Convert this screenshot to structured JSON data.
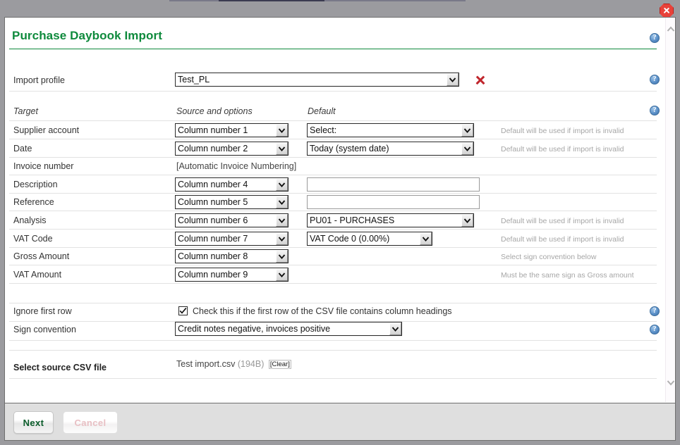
{
  "window": {
    "close_icon": "close-icon"
  },
  "page": {
    "title": "Purchase Daybook Import"
  },
  "profile": {
    "label": "Import profile",
    "value": "Test_PL",
    "delete_icon": "delete-icon",
    "help_icon": "help-icon"
  },
  "columns": {
    "target": "Target",
    "source": "Source and options",
    "default": "Default"
  },
  "rows": [
    {
      "target": "Supplier account",
      "source": "Column number 1",
      "source_type": "select",
      "default": "Select:",
      "default_type": "select",
      "default_width": 237,
      "hint": "Default will be used if import is invalid"
    },
    {
      "target": "Date",
      "source": "Column number 2",
      "source_type": "select",
      "default": "Today (system date)",
      "default_type": "select",
      "default_width": 237,
      "hint": "Default will be used if import is invalid"
    },
    {
      "target": "Invoice number",
      "source": "[Automatic Invoice Numbering]",
      "source_type": "text-static",
      "default": "",
      "default_type": "none",
      "hint": ""
    },
    {
      "target": "Description",
      "source": "Column number 4",
      "source_type": "select",
      "default": "",
      "default_type": "input",
      "default_width": 245,
      "hint": ""
    },
    {
      "target": "Reference",
      "source": "Column number 5",
      "source_type": "select",
      "default": "",
      "default_type": "input",
      "default_width": 245,
      "hint": ""
    },
    {
      "target": "Analysis",
      "source": "Column number 6",
      "source_type": "select",
      "default": "PU01 - PURCHASES",
      "default_type": "select",
      "default_width": 237,
      "hint": "Default will be used if import is invalid"
    },
    {
      "target": "VAT Code",
      "source": "Column number 7",
      "source_type": "select",
      "default": "VAT Code 0 (0.00%)",
      "default_type": "select",
      "default_width": 178,
      "hint": "Default will be used if import is invalid"
    },
    {
      "target": "Gross Amount",
      "source": "Column number 8",
      "source_type": "select",
      "default": "",
      "default_type": "none",
      "hint": "Select sign convention below"
    },
    {
      "target": "VAT Amount",
      "source": "Column number 9",
      "source_type": "select",
      "default": "",
      "default_type": "none",
      "hint": "Must be the same sign as Gross amount"
    }
  ],
  "ignore_first_row": {
    "label": "Ignore first row",
    "checked": true,
    "description": "Check this if the first row of the CSV file contains column headings"
  },
  "sign_convention": {
    "label": "Sign convention",
    "value": "Credit notes negative, invoices positive"
  },
  "csv_file": {
    "label": "Select source CSV file",
    "name": "Test import.csv",
    "size": "(194B)",
    "clear_label": "[Clear]"
  },
  "buttons": {
    "next": "Next",
    "cancel": "Cancel"
  },
  "scrollbar": {
    "up_icon": "chevron-up-icon",
    "down_icon": "chevron-down-icon"
  },
  "colors": {
    "heading_green": "#0e8a3c",
    "close_red": "#e8423a",
    "delete_red": "#c0272d",
    "help_blue": "#5b90c8"
  }
}
